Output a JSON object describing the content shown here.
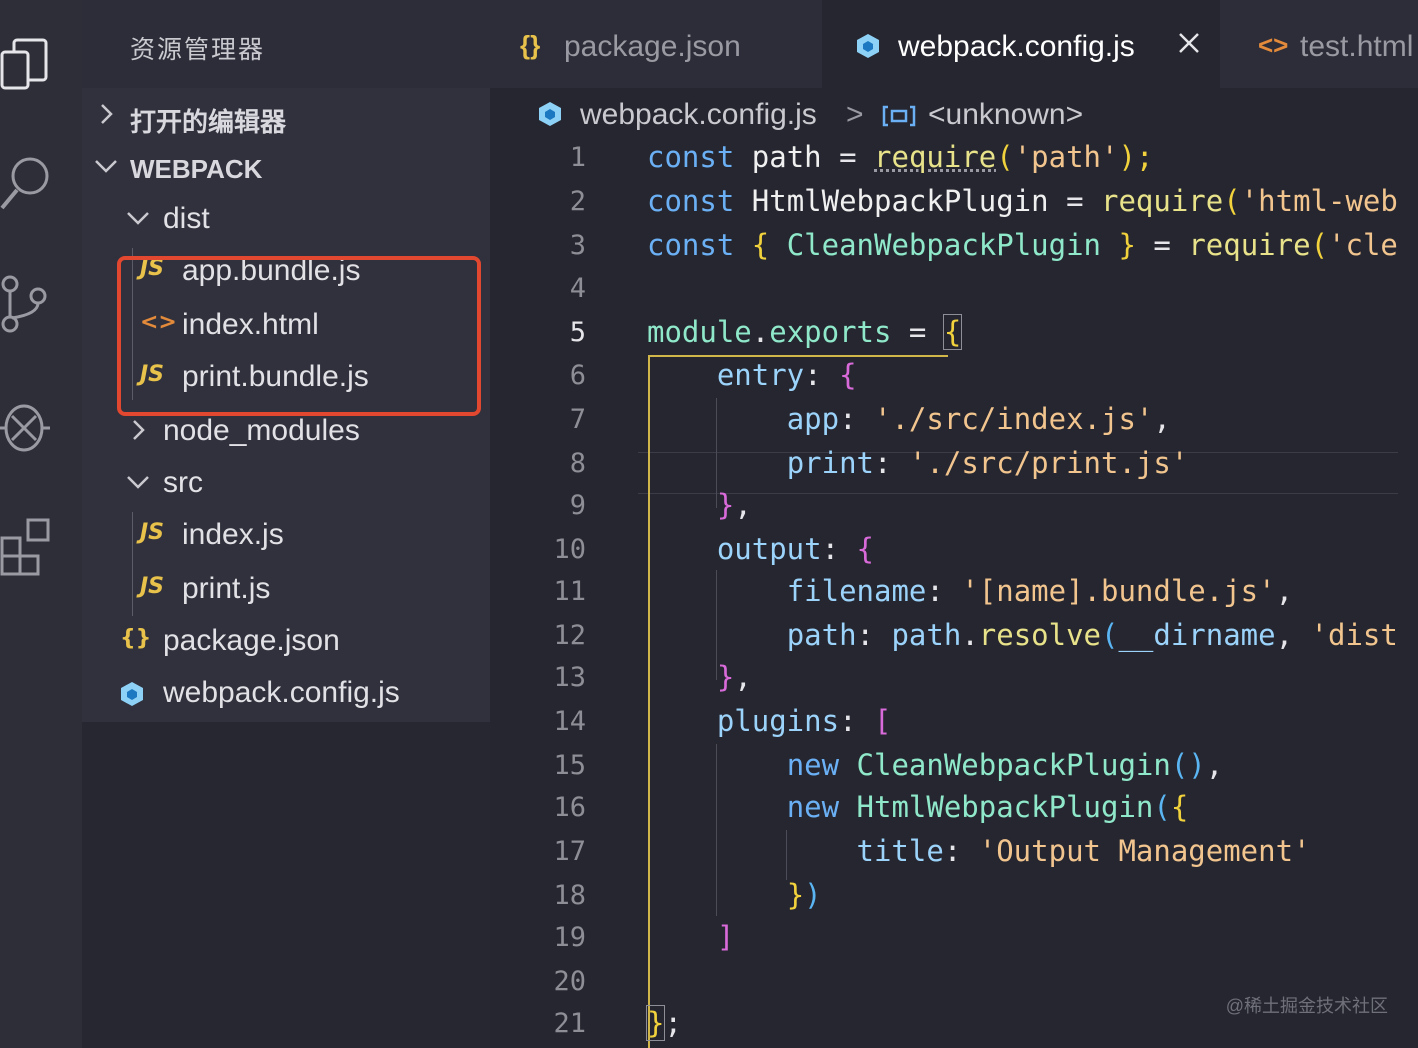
{
  "sidebar": {
    "title": "资源管理器",
    "sections": {
      "open_editors": "打开的编辑器",
      "project": "WEBPACK"
    },
    "tree": {
      "dist": "dist",
      "app_bundle": "app.bundle.js",
      "index_html": "index.html",
      "print_bundle": "print.bundle.js",
      "node_modules": "node_modules",
      "src": "src",
      "src_index": "index.js",
      "src_print": "print.js",
      "package_json": "package.json",
      "webpack_config": "webpack.config.js"
    },
    "icons": {
      "js": "JS",
      "html": "<>",
      "json": "{}"
    }
  },
  "tabs": [
    {
      "label": "package.json",
      "icon": "{}"
    },
    {
      "label": "webpack.config.js",
      "icon": "webpack-cube-icon"
    },
    {
      "label": "test.html",
      "icon": "<>"
    }
  ],
  "breadcrumb": {
    "file": "webpack.config.js",
    "separator": ">",
    "symbol": "<unknown>"
  },
  "editor": {
    "active_line": 5,
    "line_numbers": [
      "1",
      "2",
      "3",
      "4",
      "5",
      "6",
      "7",
      "8",
      "9",
      "10",
      "11",
      "12",
      "13",
      "14",
      "15",
      "16",
      "17",
      "18",
      "19",
      "20",
      "21"
    ],
    "code": {
      "l1": [
        "const",
        "path",
        "=",
        "require",
        "(",
        "'path'",
        ");"
      ],
      "l2": [
        "const",
        "HtmlWebpackPlugin",
        "=",
        "require",
        "(",
        "'html-webpack-plugin'"
      ],
      "l3": [
        "const",
        "{",
        "CleanWebpackPlugin",
        "}",
        "=",
        "require",
        "(",
        "'clean-webpack-plugin'"
      ],
      "l5": [
        "module",
        ".",
        "exports",
        "=",
        "{"
      ],
      "l6": [
        "entry",
        ":",
        "{"
      ],
      "l7": [
        "app",
        ":",
        "'./src/index.js'",
        ","
      ],
      "l8": [
        "print",
        ":",
        "'./src/print.js'"
      ],
      "l9": [
        "}",
        ","
      ],
      "l10": [
        "output",
        ":",
        "{"
      ],
      "l11": [
        "filename",
        ":",
        "'[name].bundle.js'",
        ","
      ],
      "l12": [
        "path",
        ":",
        "path",
        ".",
        "resolve",
        "(",
        "__dirname",
        ",",
        "'dist'"
      ],
      "l13": [
        "}",
        ","
      ],
      "l14": [
        "plugins",
        ":",
        "["
      ],
      "l15": [
        "new",
        "CleanWebpackPlugin",
        "()",
        ","
      ],
      "l16": [
        "new",
        "HtmlWebpackPlugin",
        "(",
        "{"
      ],
      "l17": [
        "title",
        ":",
        "'Output Management'"
      ],
      "l18": [
        "}",
        ")"
      ],
      "l19": [
        "]"
      ],
      "l21": [
        "}",
        ";"
      ]
    }
  },
  "watermark": "@稀土掘金技术社区",
  "colors": {
    "highlight_box": "#e2472f",
    "keyword": "#6bb0f5",
    "string": "#f2c58f",
    "function": "#e8e28a",
    "class": "#8fe8c9"
  }
}
